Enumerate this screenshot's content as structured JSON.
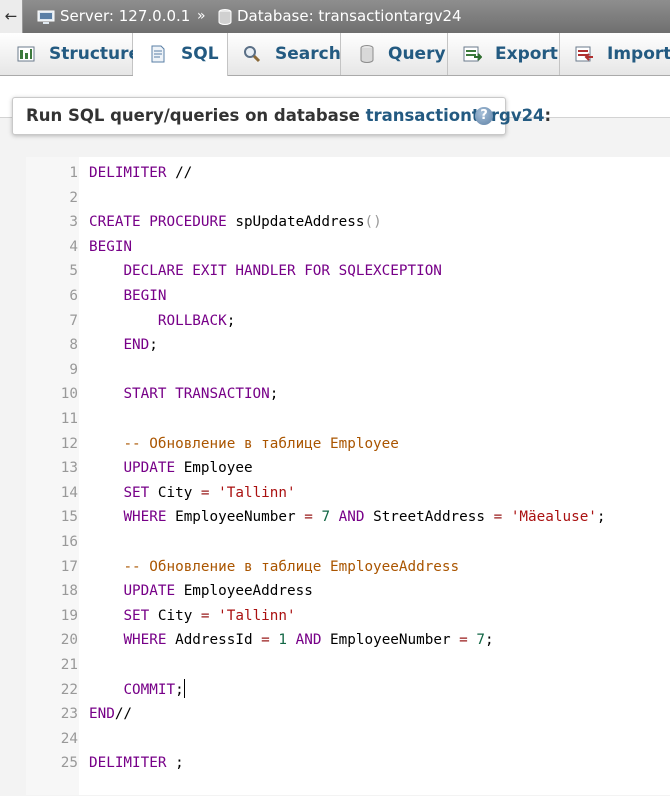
{
  "breadcrumb": {
    "back_glyph": "←",
    "server_label": "Server: 127.0.0.1",
    "separator": "»",
    "database_label": "Database: transactiontargv24"
  },
  "tabs": [
    {
      "label": "Structure",
      "icon": "structure-icon",
      "active": false
    },
    {
      "label": "SQL",
      "icon": "sql-icon",
      "active": true
    },
    {
      "label": "Search",
      "icon": "search-icon",
      "active": false
    },
    {
      "label": "Query",
      "icon": "query-icon",
      "active": false
    },
    {
      "label": "Export",
      "icon": "export-icon",
      "active": false
    },
    {
      "label": "Import",
      "icon": "import-icon",
      "active": false
    }
  ],
  "header": {
    "prefix": "Run SQL query/queries on database ",
    "database": "transactiontargv24",
    "suffix": ":",
    "help_icon": "?"
  },
  "editor": {
    "lines": [
      {
        "n": "1",
        "tokens": [
          [
            "kw",
            "DELIMITER"
          ],
          [
            "id",
            " //"
          ]
        ]
      },
      {
        "n": "2",
        "tokens": []
      },
      {
        "n": "3",
        "tokens": [
          [
            "kw",
            "CREATE PROCEDURE"
          ],
          [
            "id",
            " spUpdateAddress"
          ],
          [
            "pn",
            "()"
          ]
        ]
      },
      {
        "n": "4",
        "tokens": [
          [
            "kw",
            "BEGIN"
          ]
        ]
      },
      {
        "n": "5",
        "tokens": [
          [
            "id",
            "    "
          ],
          [
            "kw",
            "DECLARE EXIT HANDLER FOR SQLEXCEPTION"
          ]
        ]
      },
      {
        "n": "6",
        "tokens": [
          [
            "id",
            "    "
          ],
          [
            "kw",
            "BEGIN"
          ]
        ]
      },
      {
        "n": "7",
        "tokens": [
          [
            "id",
            "        "
          ],
          [
            "kw",
            "ROLLBACK"
          ],
          [
            "id",
            ";"
          ]
        ]
      },
      {
        "n": "8",
        "tokens": [
          [
            "id",
            "    "
          ],
          [
            "kw",
            "END"
          ],
          [
            "id",
            ";"
          ]
        ]
      },
      {
        "n": "9",
        "tokens": []
      },
      {
        "n": "10",
        "tokens": [
          [
            "id",
            "    "
          ],
          [
            "kw",
            "START TRANSACTION"
          ],
          [
            "id",
            ";"
          ]
        ]
      },
      {
        "n": "11",
        "tokens": []
      },
      {
        "n": "12",
        "tokens": [
          [
            "id",
            "    "
          ],
          [
            "cm",
            "-- Обновление в таблице Employee"
          ]
        ]
      },
      {
        "n": "13",
        "tokens": [
          [
            "id",
            "    "
          ],
          [
            "kw",
            "UPDATE"
          ],
          [
            "id",
            " Employee"
          ]
        ]
      },
      {
        "n": "14",
        "tokens": [
          [
            "id",
            "    "
          ],
          [
            "kw",
            "SET"
          ],
          [
            "id",
            " City "
          ],
          [
            "op",
            "="
          ],
          [
            "id",
            " "
          ],
          [
            "str",
            "'Tallinn'"
          ]
        ]
      },
      {
        "n": "15",
        "tokens": [
          [
            "id",
            "    "
          ],
          [
            "kw",
            "WHERE"
          ],
          [
            "id",
            " EmployeeNumber "
          ],
          [
            "op",
            "="
          ],
          [
            "id",
            " "
          ],
          [
            "num",
            "7"
          ],
          [
            "id",
            " "
          ],
          [
            "kw",
            "AND"
          ],
          [
            "id",
            " StreetAddress "
          ],
          [
            "op",
            "="
          ],
          [
            "id",
            " "
          ],
          [
            "str",
            "'Mäealuse'"
          ],
          [
            "id",
            ";"
          ]
        ]
      },
      {
        "n": "16",
        "tokens": []
      },
      {
        "n": "17",
        "tokens": [
          [
            "id",
            "    "
          ],
          [
            "cm",
            "-- Обновление в таблице EmployeeAddress"
          ]
        ]
      },
      {
        "n": "18",
        "tokens": [
          [
            "id",
            "    "
          ],
          [
            "kw",
            "UPDATE"
          ],
          [
            "id",
            " EmployeeAddress"
          ]
        ]
      },
      {
        "n": "19",
        "tokens": [
          [
            "id",
            "    "
          ],
          [
            "kw",
            "SET"
          ],
          [
            "id",
            " City "
          ],
          [
            "op",
            "="
          ],
          [
            "id",
            " "
          ],
          [
            "str",
            "'Tallinn'"
          ]
        ]
      },
      {
        "n": "20",
        "tokens": [
          [
            "id",
            "    "
          ],
          [
            "kw",
            "WHERE"
          ],
          [
            "id",
            " AddressId "
          ],
          [
            "op",
            "="
          ],
          [
            "id",
            " "
          ],
          [
            "num",
            "1"
          ],
          [
            "id",
            " "
          ],
          [
            "kw",
            "AND"
          ],
          [
            "id",
            " EmployeeNumber "
          ],
          [
            "op",
            "="
          ],
          [
            "id",
            " "
          ],
          [
            "num",
            "7"
          ],
          [
            "id",
            ";"
          ]
        ]
      },
      {
        "n": "21",
        "tokens": []
      },
      {
        "n": "22",
        "tokens": [
          [
            "id",
            "    "
          ],
          [
            "kw",
            "COMMIT"
          ],
          [
            "id",
            ";"
          ],
          [
            "cursor",
            ""
          ]
        ]
      },
      {
        "n": "23",
        "tokens": [
          [
            "kw",
            "END"
          ],
          [
            "id",
            "//"
          ]
        ]
      },
      {
        "n": "24",
        "tokens": []
      },
      {
        "n": "25",
        "tokens": [
          [
            "kw",
            "DELIMITER"
          ],
          [
            "id",
            " ;"
          ]
        ]
      }
    ]
  }
}
